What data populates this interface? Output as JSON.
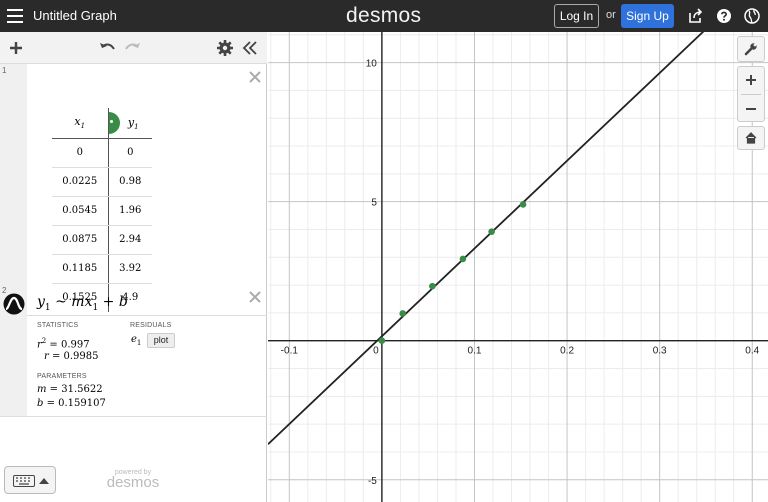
{
  "header": {
    "title": "Untitled Graph",
    "logo": "desmos",
    "login_label": "Log In",
    "or_label": "or",
    "signup_label": "Sign Up"
  },
  "expressions": [
    {
      "index": "1",
      "type": "table",
      "columns": [
        "x1",
        "y1"
      ],
      "x_sub": "1",
      "y_sub": "1",
      "rows": [
        [
          "0",
          "0"
        ],
        [
          "0.0225",
          "0.98"
        ],
        [
          "0.0545",
          "1.96"
        ],
        [
          "0.0875",
          "2.94"
        ],
        [
          "0.1185",
          "3.92"
        ],
        [
          "0.1525",
          "4.9"
        ]
      ],
      "point_color": "#388c46"
    },
    {
      "index": "2",
      "type": "regression",
      "formula_parts": {
        "y": "y",
        "y_sub": "1",
        "tilde": " ~ ",
        "m": "m",
        "x": "x",
        "x_sub": "1",
        "plus": " + ",
        "b": "b"
      },
      "statistics_label": "STATISTICS",
      "residuals_label": "RESIDUALS",
      "r2_label": "r",
      "r2_value": " = 0.997",
      "r_label": "r",
      "r_value": " = 0.9985",
      "residual_var": "e",
      "residual_sub": "1",
      "plot_label": "plot",
      "parameters_label": "PARAMETERS",
      "m_label": "m",
      "m_value": " = 31.5622",
      "b_label": "b",
      "b_value": " = 0.159107"
    }
  ],
  "footer": {
    "powered_by": "powered by",
    "brand": "desmos"
  },
  "chart_data": {
    "type": "scatter",
    "x_ticks": [
      "-0.1",
      "0",
      "0.1",
      "0.2",
      "0.3",
      "0.4"
    ],
    "y_ticks": [
      "-5",
      "5",
      "10"
    ],
    "xlim": [
      -0.123,
      0.417
    ],
    "ylim": [
      -5.8,
      11.1
    ],
    "grid": true,
    "points": {
      "x": [
        0,
        0.0225,
        0.0545,
        0.0875,
        0.1185,
        0.1525
      ],
      "y": [
        0,
        0.98,
        1.96,
        2.94,
        3.92,
        4.9
      ]
    },
    "point_color": "#388c46",
    "line": {
      "m": 31.5622,
      "b": 0.159107,
      "color": "#222222"
    }
  }
}
